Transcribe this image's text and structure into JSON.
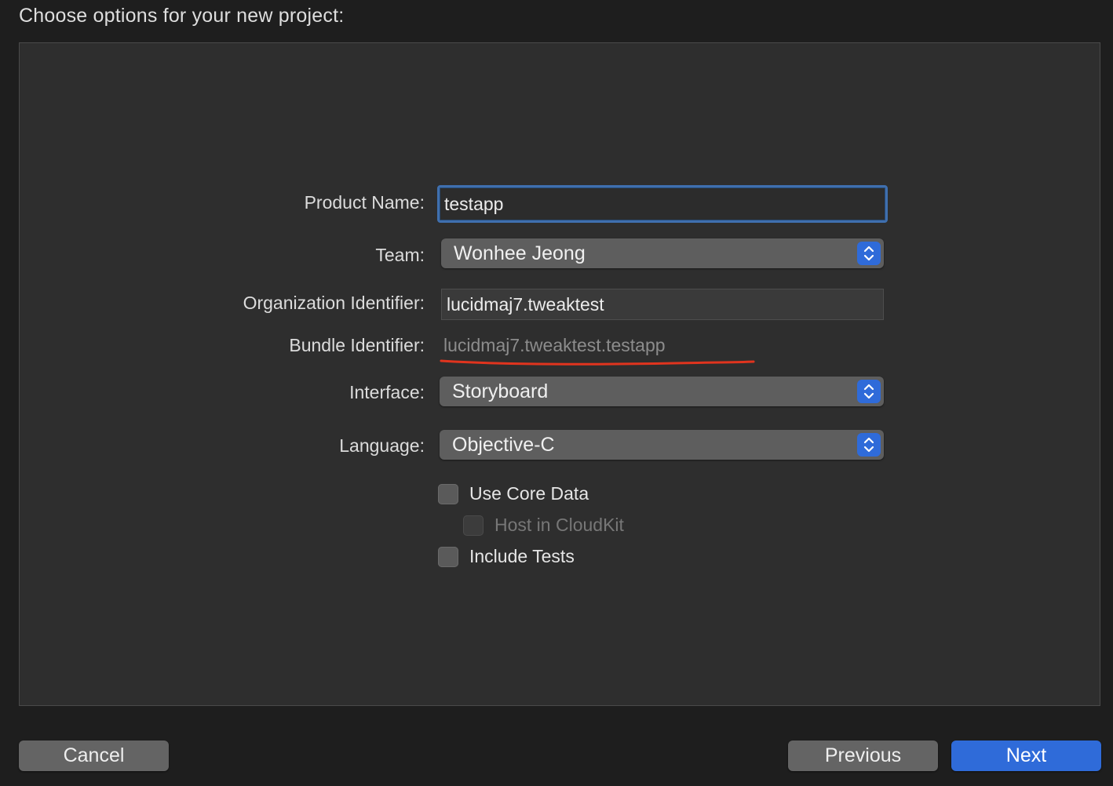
{
  "header": {
    "title": "Choose options for your new project:"
  },
  "form": {
    "product_name": {
      "label": "Product Name:",
      "value": "testapp"
    },
    "team": {
      "label": "Team:",
      "value": "Wonhee Jeong"
    },
    "organization_identifier": {
      "label": "Organization Identifier:",
      "value": "lucidmaj7.tweaktest"
    },
    "bundle_identifier": {
      "label": "Bundle Identifier:",
      "value": "lucidmaj7.tweaktest.testapp"
    },
    "interface": {
      "label": "Interface:",
      "value": "Storyboard"
    },
    "language": {
      "label": "Language:",
      "value": "Objective-C"
    },
    "checkboxes": {
      "use_core_data": {
        "label": "Use Core Data",
        "checked": false
      },
      "host_in_cloudkit": {
        "label": "Host in CloudKit",
        "checked": false,
        "enabled": false
      },
      "include_tests": {
        "label": "Include Tests",
        "checked": false
      }
    }
  },
  "footer": {
    "cancel_label": "Cancel",
    "previous_label": "Previous",
    "next_label": "Next"
  },
  "colors": {
    "accent": "#2f6bd9",
    "annotation_underline": "#e0341e",
    "focus_ring": "#3f6fae"
  },
  "icons": {
    "popup_arrows": "chevron-up-down-icon"
  }
}
